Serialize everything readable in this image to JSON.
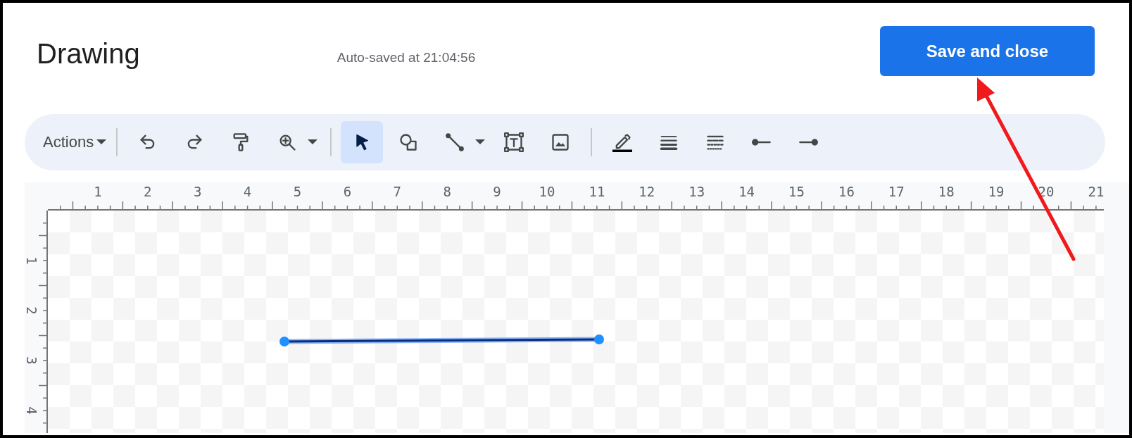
{
  "window": {
    "title": "Drawing",
    "autosave": "Auto-saved at 21:04:56",
    "save_button": "Save and close"
  },
  "toolbar": {
    "menu_label": "Actions",
    "tools": [
      {
        "selected": false
      },
      {
        "selected": false
      },
      {
        "selected": false
      },
      {
        "selected": false
      },
      {
        "selected": true
      },
      {
        "selected": false
      },
      {
        "selected": false
      },
      {
        "selected": false
      },
      {
        "selected": false
      },
      {
        "selected": false
      },
      {
        "selected": false
      },
      {
        "selected": false
      },
      {
        "selected": false
      },
      {
        "selected": false
      }
    ]
  },
  "ruler": {
    "horizontal": [
      "1",
      "2",
      "3",
      "4",
      "5",
      "6",
      "7",
      "8",
      "9",
      "10",
      "11",
      "12",
      "13",
      "14",
      "15",
      "16",
      "17",
      "18",
      "19",
      "20",
      "21"
    ],
    "vertical": [
      "1",
      "2",
      "3",
      "4"
    ]
  },
  "canvas": {
    "line": {
      "selected": true
    }
  }
}
